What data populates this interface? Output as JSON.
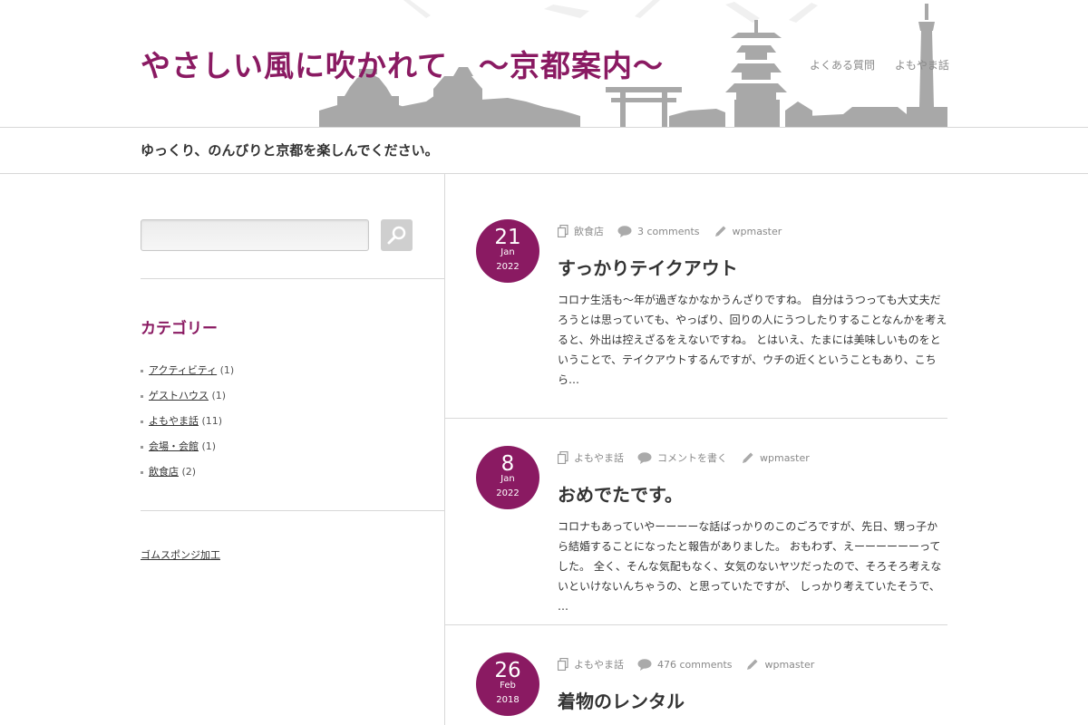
{
  "header": {
    "site_title": "やさしい風に吹かれて　〜京都案内〜",
    "nav": [
      "よくある質問",
      "よもやま話"
    ],
    "tagline": "ゆっくり、のんびりと京都を楽しんでください。"
  },
  "sidebar": {
    "search": {
      "placeholder": "",
      "value": ""
    },
    "categories_title": "カテゴリー",
    "categories": [
      {
        "label": "アクティビティ",
        "count": "(1)"
      },
      {
        "label": "ゲストハウス",
        "count": "(1)"
      },
      {
        "label": "よもやま話",
        "count": "(11)"
      },
      {
        "label": "会場・会館",
        "count": "(1)"
      },
      {
        "label": "飲食店",
        "count": "(2)"
      }
    ],
    "extra_link": "ゴムスポンジ加工"
  },
  "posts": [
    {
      "day": "21",
      "month": "Jan",
      "year": "2022",
      "category": "飲食店",
      "comments": "3 comments",
      "author": "wpmaster",
      "title": "すっかりテイクアウト",
      "excerpt": "コロナ生活も〜年が過ぎなかなかうんざりですね。 自分はうつっても大丈夫だろうとは思っていても、やっぱり、回りの人にうつしたりすることなんかを考えると、外出は控えざるをえないですね。 とはいえ、たまには美味しいものをということで、テイクアウトするんですが、ウチの近くということもあり、こちら…"
    },
    {
      "day": "8",
      "month": "Jan",
      "year": "2022",
      "category": "よもやま話",
      "comments": "コメントを書く",
      "author": "wpmaster",
      "title": "おめでたです。",
      "excerpt": "コロナもあっていやーーーーな話ばっかりのこのごろですが、先日、甥っ子から結婚することになったと報告がありました。 おもわず、えーーーーーーってした。 全く、そんな気配もなく、女気のないヤツだったので、そろそろ考えないといけないんちゃうの、と思っていたですが、 しっかり考えていたそうで、 …"
    },
    {
      "day": "26",
      "month": "Feb",
      "year": "2018",
      "category": "よもやま話",
      "comments": "476 comments",
      "author": "wpmaster",
      "title": "着物のレンタル",
      "excerpt": ""
    }
  ],
  "colors": {
    "accent": "#8a1a62",
    "skyline": "#a8a8a8",
    "border": "#d8d8d8"
  },
  "icons": [
    "search-icon",
    "document-icon",
    "comment-icon",
    "pencil-icon"
  ]
}
